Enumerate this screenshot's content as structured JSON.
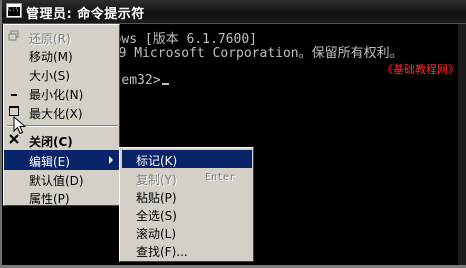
{
  "window": {
    "title": "管理员: 命令提示符"
  },
  "console": {
    "line1": "Microsoft Windows [版本 6.1.7600]",
    "line2": "版权所有 (c) 2009 Microsoft Corporation。保留所有权利。",
    "line3": "C:\\Windows\\system32>",
    "watermark": "《基础教程网》"
  },
  "system_menu": {
    "items": [
      {
        "label": "还原(R)",
        "disabled": true
      },
      {
        "label": "移动(M)"
      },
      {
        "label": "大小(S)"
      },
      {
        "label": "最小化(N)"
      },
      {
        "label": "最大化(X)"
      },
      {
        "label": "关闭(C)"
      },
      {
        "label": "编辑(E)",
        "selected": true
      },
      {
        "label": "默认值(D)"
      },
      {
        "label": "属性(P)"
      }
    ]
  },
  "edit_submenu": {
    "items": [
      {
        "label": "标记(K)",
        "selected": true
      },
      {
        "label": "复制(Y)",
        "accelerator": "Enter",
        "disabled": true
      },
      {
        "label": "粘贴(P)"
      },
      {
        "label": "全选(S)"
      },
      {
        "label": "滚动(L)"
      },
      {
        "label": "查找(F)..."
      }
    ]
  },
  "colors": {
    "menu_highlight": "#0a246a",
    "menu_bg": "#d4d0c8",
    "watermark": "#ff2a2a"
  }
}
